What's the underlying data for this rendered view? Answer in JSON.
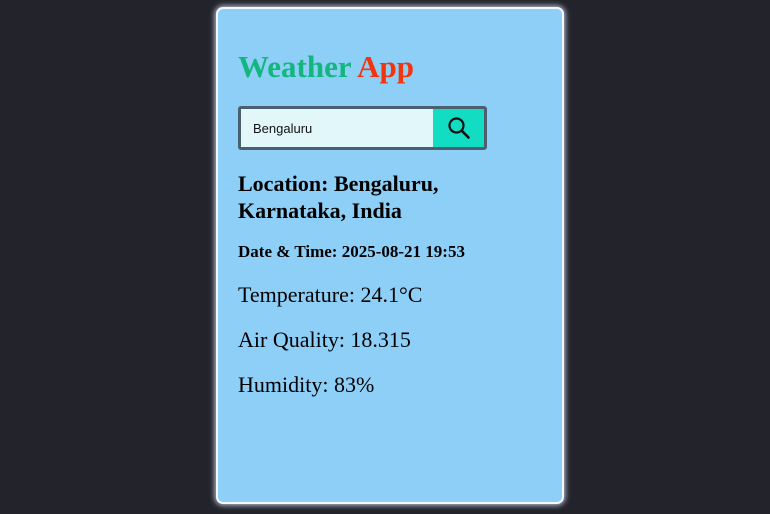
{
  "app": {
    "title_word1": "Weather",
    "title_word2": "App"
  },
  "search": {
    "value": "Bengaluru",
    "button_icon": "search-icon"
  },
  "weather": {
    "location": "Location: Bengaluru, Karnataka, India",
    "datetime": "Date & Time: 2025-08-21 19:53",
    "temperature": "Temperature: 24.1°C",
    "air_quality": "Air Quality: 18.315",
    "humidity": "Humidity: 83%"
  },
  "colors": {
    "page_background": "#23232c",
    "card_background": "#8ecff8",
    "title_weather": "#13b67c",
    "title_app": "#f2350e",
    "search_button": "#12dcc1",
    "search_input": "#e1f7f9"
  }
}
